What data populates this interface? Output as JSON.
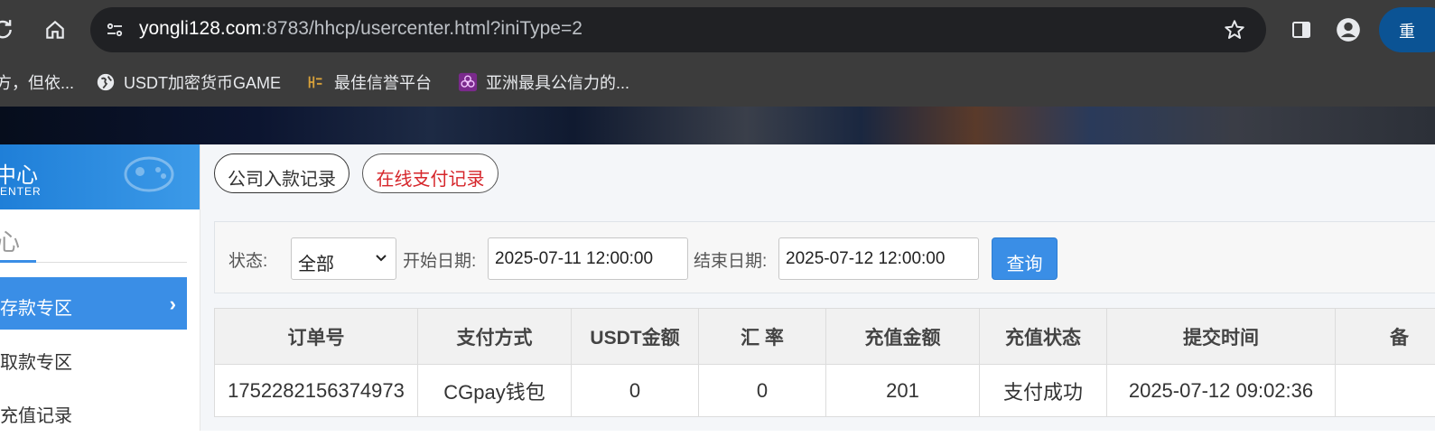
{
  "browser": {
    "url_host": "yongli128.com",
    "url_rest": ":8783/hhcp/usercenter.html?iniType=2",
    "profile_label": "重",
    "bookmarks": [
      {
        "label": "方，但依...",
        "icon": "none"
      },
      {
        "label": "USDT加密货币GAME",
        "icon": "globe-icon"
      },
      {
        "label": "最佳信誉平台",
        "icon": "site-logo-icon"
      },
      {
        "label": "亚洲最具公信力的...",
        "icon": "flower-logo-icon"
      }
    ]
  },
  "sidebar": {
    "header_title": "中心",
    "header_subtitle": "ENTER",
    "section_tab": "心",
    "items": [
      {
        "label": "存款专区",
        "active": true
      },
      {
        "label": "取款专区",
        "active": false
      },
      {
        "label": "充值记录",
        "active": false
      }
    ]
  },
  "tabs": [
    {
      "label": "公司入款记录",
      "active": false
    },
    {
      "label": "在线支付记录",
      "active": true
    }
  ],
  "filter": {
    "status_label": "状态:",
    "status_value": "全部",
    "start_label": "开始日期:",
    "start_value": "2025-07-11 12:00:00",
    "end_label": "结束日期:",
    "end_value": "2025-07-12 12:00:00",
    "query_label": "查询"
  },
  "table": {
    "columns": [
      "订单号",
      "支付方式",
      "USDT金额",
      "汇 率",
      "充值金额",
      "充值状态",
      "提交时间",
      "备"
    ],
    "rows": [
      [
        "1752282156374973",
        "CGpay钱包",
        "0",
        "0",
        "201",
        "支付成功",
        "2025-07-12 09:02:36",
        ""
      ]
    ]
  },
  "colors": {
    "accent": "#3a8ee6",
    "active_tab_text": "#d6262b",
    "chrome_bg": "#3c3c3c"
  }
}
